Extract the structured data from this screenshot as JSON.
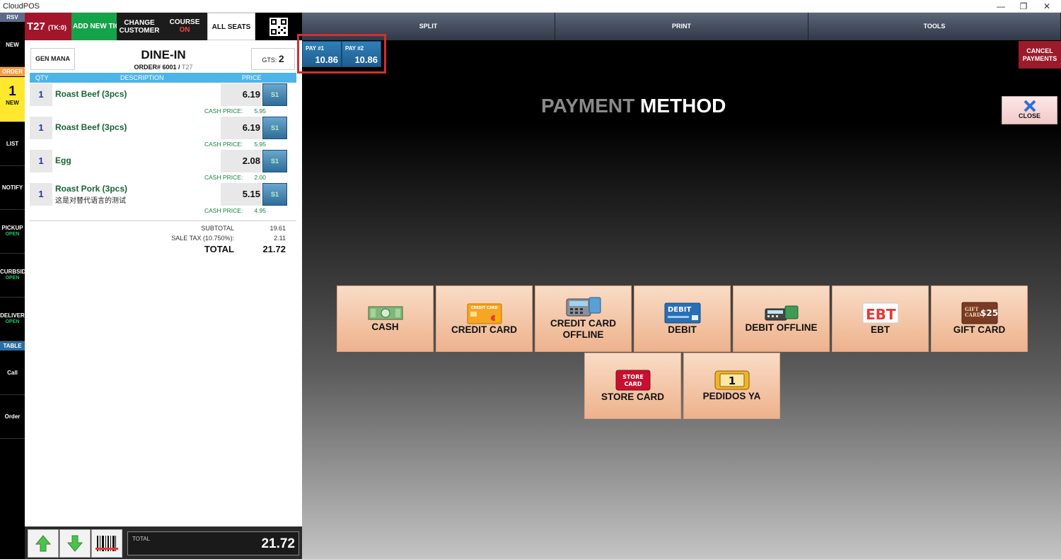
{
  "window": {
    "title": "CloudPOS",
    "minimize": "—",
    "restore": "❐",
    "close": "✕"
  },
  "leftnav": {
    "rsv": "RSV",
    "new": "NEW",
    "order_header": "ORDER",
    "order_count": "1",
    "order_new": "NEW",
    "list": "LIST",
    "notify": "NOTIFY",
    "pickup": "PICKUP",
    "pickup_status": "OPEN",
    "curbside": "CURBSID",
    "curbside_status": "OPEN",
    "delivery": "DELIVER",
    "delivery_status": "OPEN",
    "table_header": "TABLE",
    "call": "Call",
    "order": "Order"
  },
  "topbar": {
    "table": "T27",
    "ticket": "(TK:0)",
    "add_new": "ADD NEW TIC",
    "change_customer_1": "CHANGE",
    "change_customer_2": "CUSTOMER",
    "course": "COURSE",
    "course_status": "ON",
    "all_seats": "ALL SEATS"
  },
  "order": {
    "gen_mana": "GEN MANA",
    "type": "DINE-IN",
    "order_label": "ORDER# 6001 /",
    "table": "T27",
    "guests_label": "GTS:",
    "guests": "2",
    "columns": {
      "qty": "QTY",
      "description": "DESCRIPTION",
      "price": "PRICE"
    },
    "items": [
      {
        "qty": "1",
        "name": "Roast Beef (3pcs)",
        "alt": "",
        "price": "6.19",
        "seat": "S1",
        "cash_label": "CASH PRICE:",
        "cash": "5.95"
      },
      {
        "qty": "1",
        "name": "Roast Beef (3pcs)",
        "alt": "",
        "price": "6.19",
        "seat": "S1",
        "cash_label": "CASH PRICE:",
        "cash": "5.95"
      },
      {
        "qty": "1",
        "name": "Egg",
        "alt": "",
        "price": "2.08",
        "seat": "S1",
        "cash_label": "CASH PRICE:",
        "cash": "2.00"
      },
      {
        "qty": "1",
        "name": "Roast Pork (3pcs)",
        "alt": "这是对替代语言的测试",
        "price": "5.15",
        "seat": "S1",
        "cash_label": "CASH PRICE:",
        "cash": "4.95"
      }
    ],
    "subtotal_label": "SUBTOTAL",
    "subtotal": "19.61",
    "tax_label": "SALE TAX (10.750%):",
    "tax": "2.11",
    "total_label": "TOTAL",
    "total": "21.72"
  },
  "bottom": {
    "total_label": "TOTAL",
    "total": "21.72"
  },
  "right": {
    "tabs": {
      "split": "SPLIT",
      "print": "PRINT",
      "tools": "TOOLS"
    },
    "splits": [
      {
        "label": "PAY #1",
        "amount": "10.86"
      },
      {
        "label": "PAY #2",
        "amount": "10.86"
      }
    ],
    "cancel_1": "CANCEL",
    "cancel_2": "PAYMENTS",
    "close": "CLOSE",
    "title_grey": "PAYMENT",
    "title_white": "METHOD",
    "methods": {
      "cash": "CASH",
      "credit_card": "CREDIT CARD",
      "credit_offline_1": "CREDIT CARD",
      "credit_offline_2": "OFFLINE",
      "debit": "DEBIT",
      "debit_offline": "DEBIT OFFLINE",
      "ebt": "EBT",
      "gift_card": "GIFT CARD",
      "store_card": "STORE CARD",
      "pedidos_ya": "PEDIDOS YA"
    },
    "icon_text": {
      "credit_card": "CREDIT CARD",
      "debit": "DEBIT",
      "ebt": "EBT",
      "gift_1": "GIFT",
      "gift_2": "CARD",
      "gift_amount": "$25",
      "store_1": "STORE",
      "store_2": "CARD",
      "pedidos": "1"
    }
  },
  "colors": {
    "accent_blue": "#4db4e8",
    "cancel_red": "#9b1b2b",
    "table_red": "#a3152a",
    "green_btn": "#15a34a",
    "pay_btn_top": "#f9dcc6",
    "pay_btn_bottom": "#eeb28c"
  }
}
